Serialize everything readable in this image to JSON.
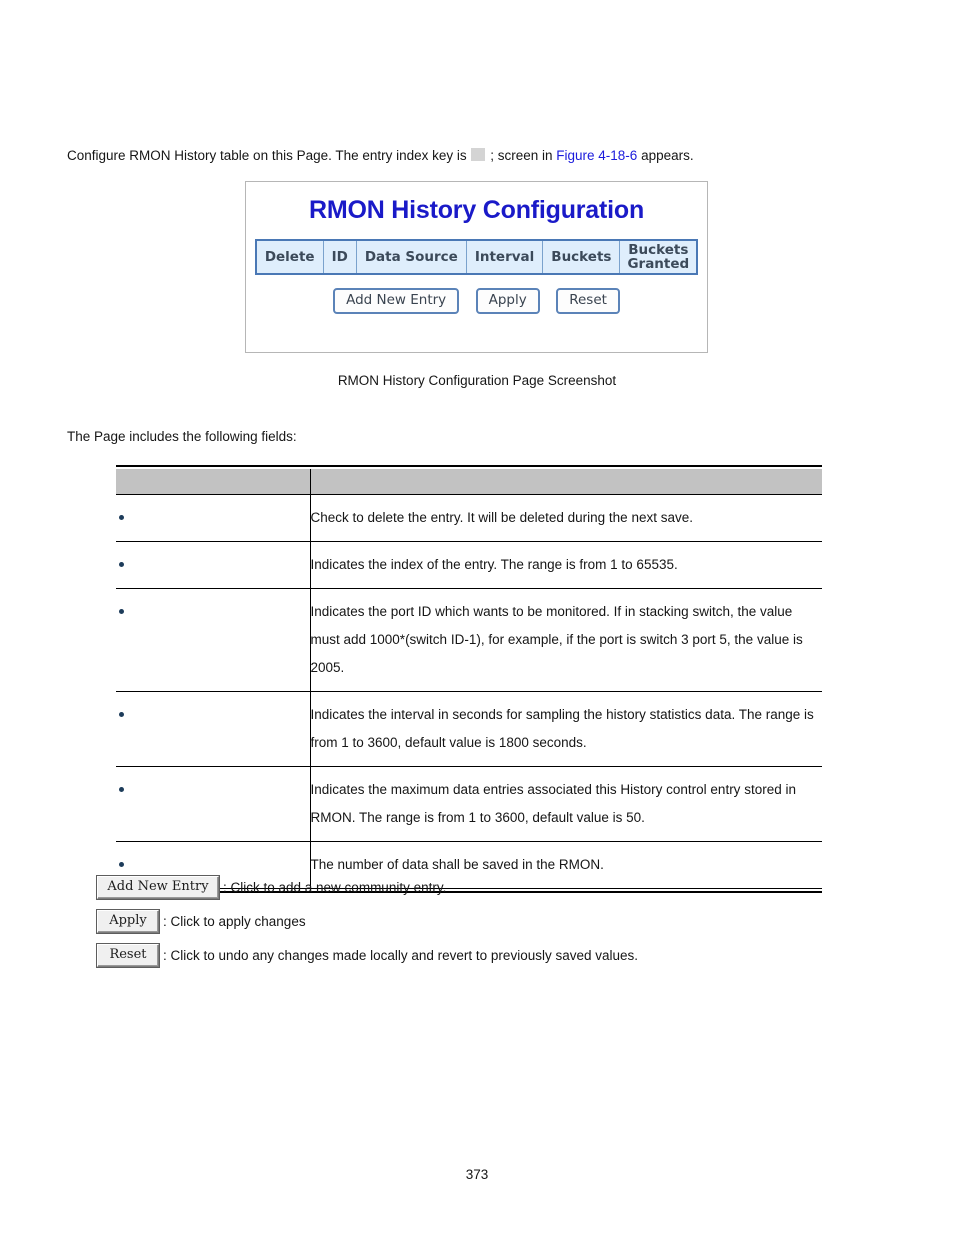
{
  "intro": {
    "text_before": "Configure RMON History table on this Page. The entry index key is",
    "blank_field": "",
    "text_middle": "; screen in",
    "link_text": "Figure 4-18-6",
    "text_after": "appears."
  },
  "figure": {
    "panel_title": "RMON History Configuration",
    "table_headers": [
      "Delete",
      "ID",
      "Data Source",
      "Interval",
      "Buckets",
      "Buckets Granted"
    ],
    "header_buckets_granted_line1": "Buckets",
    "header_buckets_granted_line2": "Granted",
    "buttons": [
      "Add New Entry",
      "Apply",
      "Reset"
    ],
    "caption": "RMON History Configuration Page Screenshot",
    "title_color": "#1a1ac8",
    "header_bg": "#dfeefc",
    "header_border": "#7aa2cd"
  },
  "lead_in": "The Page includes the following fields:",
  "fields_table": {
    "headers": [
      "",
      ""
    ],
    "header_bg": "#c2c2c2",
    "bullet_color": "#1d3c5a",
    "rows": [
      {
        "name": "",
        "description": "Check to delete the entry. It will be deleted during the next save."
      },
      {
        "name": "",
        "description": "Indicates the index of the entry. The range is from 1 to 65535."
      },
      {
        "name": "",
        "description": "Indicates the port ID which wants to be monitored. If in stacking switch, the value must add 1000*(switch ID-1), for example, if the port is switch 3 port 5, the value is 2005."
      },
      {
        "name": "",
        "description": "Indicates the interval in seconds for sampling the history statistics data. The range is from 1 to 3600, default value is 1800 seconds."
      },
      {
        "name": "",
        "description": "Indicates the maximum data entries associated this History control entry stored in RMON. The range is from 1 to 3600, default value is 50."
      },
      {
        "name": "",
        "description": "The number of data shall be saved in the RMON."
      }
    ]
  },
  "legend": [
    {
      "button": "Add New Entry",
      "text": ": Click to add a new community entry."
    },
    {
      "button": "Apply",
      "text": ": Click to apply changes"
    },
    {
      "button": "Reset",
      "text": ": Click to undo any changes made locally and revert to previously saved values."
    }
  ],
  "page_number": "373"
}
